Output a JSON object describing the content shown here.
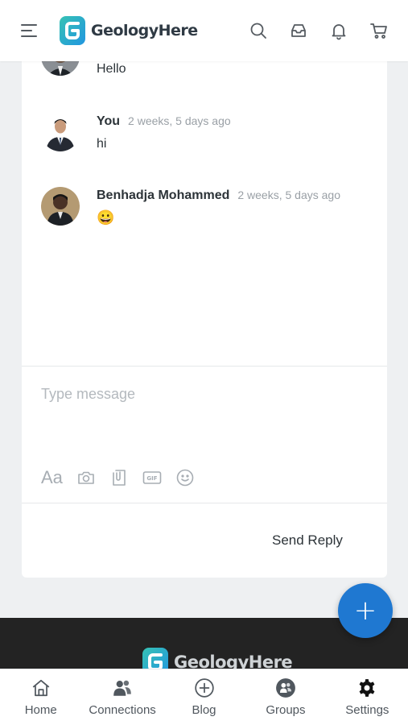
{
  "header": {
    "brand": "GeologyHere",
    "icons": [
      "menu-icon",
      "search-icon",
      "inbox-icon",
      "bell-icon",
      "cart-icon"
    ]
  },
  "messages": [
    {
      "author": "",
      "time": "",
      "text": "Hello",
      "avatar": "avatar-partial"
    },
    {
      "author": "You",
      "time": "2 weeks, 5 days ago",
      "text": "hi",
      "avatar": "avatar-you"
    },
    {
      "author": "Benhadja Mohammed",
      "time": "2 weeks, 5 days ago",
      "text": "😀",
      "avatar": "avatar-benhadja"
    }
  ],
  "composer": {
    "placeholder": "Type message",
    "format_label": "Aa",
    "tools": [
      "camera-icon",
      "attachment-icon",
      "gif-icon",
      "emoji-icon"
    ],
    "send_label": "Send Reply"
  },
  "fab": {
    "label": "+"
  },
  "footer": {
    "brand": "GeologyHere"
  },
  "bottom_nav": [
    {
      "label": "Home",
      "icon": "home-icon"
    },
    {
      "label": "Connections",
      "icon": "connections-icon"
    },
    {
      "label": "Blog",
      "icon": "plus-circle-icon"
    },
    {
      "label": "Groups",
      "icon": "groups-icon"
    },
    {
      "label": "Settings",
      "icon": "gear-icon"
    }
  ],
  "colors": {
    "accent": "#1f78d1",
    "logo_blue": "#29a8e0",
    "logo_teal": "#36c2b4",
    "footer_bg": "#232323"
  }
}
